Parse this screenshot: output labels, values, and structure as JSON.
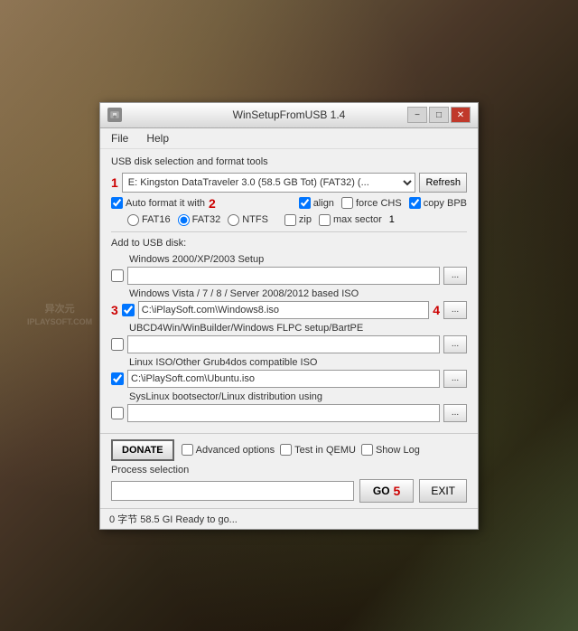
{
  "watermark": {
    "line1": "异次元",
    "line2": "IPLAYSOFT.COM"
  },
  "window": {
    "title": "WinSetupFromUSB 1.4",
    "icon": "💾",
    "buttons": {
      "minimize": "−",
      "maximize": "□",
      "close": "✕"
    }
  },
  "menu": {
    "items": [
      "File",
      "Help"
    ]
  },
  "usb_section": {
    "label": "USB disk selection and format tools",
    "step1": "1",
    "drive_value": "E: Kingston DataTraveler 3.0 (58.5 GB Tot) (FAT32) (...",
    "refresh_label": "Refresh",
    "auto_format_label": "Auto format it with",
    "step2": "2",
    "align_label": "align",
    "force_chs_label": "force CHS",
    "copy_bpb_label": "copy BPB",
    "fat16_label": "FAT16",
    "fat32_label": "FAT32",
    "ntfs_label": "NTFS",
    "zip_label": "zip",
    "max_sector_label": "max sector",
    "max_sector_value": "1"
  },
  "add_section": {
    "label": "Add to USB disk:",
    "items": [
      {
        "id": "win2000",
        "label": "Windows 2000/XP/2003 Setup",
        "checked": false,
        "path": "",
        "browse": "..."
      },
      {
        "id": "winvista",
        "label": "Windows Vista / 7 / 8 / Server 2008/2012 based ISO",
        "checked": true,
        "path": "C:\\iPlaySoft.com\\Windows8.iso",
        "browse": "...",
        "step3": "3",
        "step4": "4"
      },
      {
        "id": "ubcd4win",
        "label": "UBCD4Win/WinBuilder/Windows FLPC setup/BartPE",
        "checked": false,
        "path": "",
        "browse": "..."
      },
      {
        "id": "linux",
        "label": "Linux ISO/Other Grub4dos compatible ISO",
        "checked": true,
        "path": "C:\\iPlaySoft.com\\Ubuntu.iso",
        "browse": "..."
      },
      {
        "id": "syslinux",
        "label": "SysLinux bootsector/Linux distribution using",
        "checked": false,
        "path": "",
        "browse": "..."
      }
    ]
  },
  "bottom": {
    "donate_label": "DONATE",
    "advanced_label": "Advanced options",
    "test_qemu_label": "Test in QEMU",
    "show_log_label": "Show Log",
    "process_label": "Process selection",
    "go_label": "GO",
    "step5": "5",
    "exit_label": "EXIT"
  },
  "status": {
    "text": "0 字节  58.5 GI Ready to go..."
  }
}
